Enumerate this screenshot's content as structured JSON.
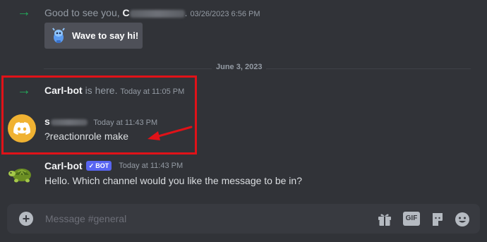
{
  "welcome": {
    "greeting": "Good to see you,",
    "name_initial": "C",
    "timestamp": "03/26/2023 6:56 PM",
    "wave_button": "Wave to say hi!"
  },
  "date_divider": "June 3, 2023",
  "join": {
    "username": "Carl-bot",
    "text": "is here.",
    "timestamp": "Today at 11:05 PM"
  },
  "user_message": {
    "username_initial": "s",
    "timestamp": "Today at 11:43 PM",
    "text": "?reactionrole make"
  },
  "bot_message": {
    "username": "Carl-bot",
    "badge": "BOT",
    "badge_check": "✓",
    "timestamp": "Today at 11:43 PM",
    "text": "Hello. Which channel would you like the message to be in?"
  },
  "composer": {
    "placeholder": "Message #general",
    "gif_label": "GIF"
  },
  "colors": {
    "background": "#313338",
    "join_green": "#23a559",
    "highlight_red": "#e01218",
    "blurple": "#5865f2",
    "discord_avatar": "#f0b232"
  },
  "icons": [
    "join-arrow-icon",
    "wumpus-icon",
    "discord-logo-icon",
    "turtle-avatar-icon",
    "add-icon",
    "gift-icon",
    "gif-icon",
    "sticker-icon",
    "emoji-icon",
    "red-arrow-annotation"
  ]
}
